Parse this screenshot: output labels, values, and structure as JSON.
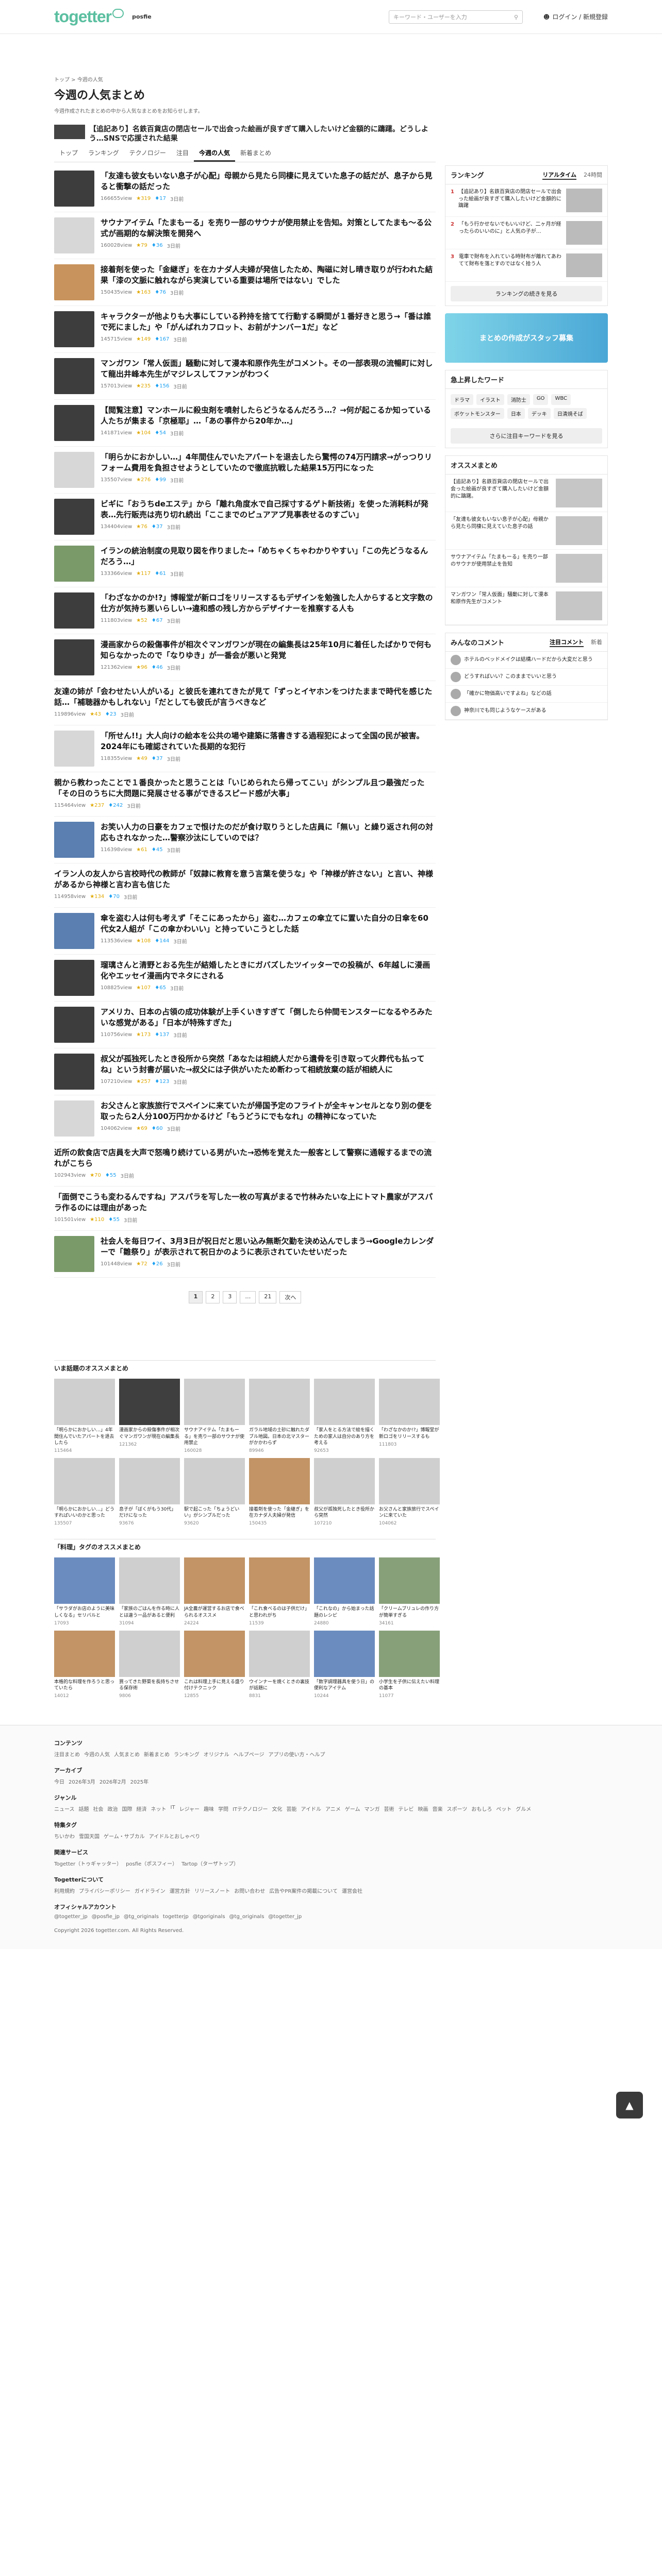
{
  "header": {
    "logo": "togetter",
    "partner": "posfie",
    "search_placeholder": "キーワード・ユーザーを入力",
    "login": "ログイン / 新規登録"
  },
  "breadcrumb": "トップ > 今週の人気",
  "page_title": "今週の人気まとめ",
  "page_desc": "今週作成されたまとめの中から人気なまとめをお知らせします。",
  "featured": "【追記あり】名鉄百貨店の閉店セールで出会った絵画が良すぎて購入したいけど金額的に躊躇。どうしよう…SNSで応援された結果",
  "tabs": [
    "トップ",
    "ランキング",
    "テクノロジー",
    "注目",
    "今週の人気",
    "新着まとめ"
  ],
  "items": [
    {
      "t": "「友達も彼女もいない息子が心配」母親から見たら同棲に見えていた息子の話だが、息子から見ると衝撃の話だった",
      "m": "166655view",
      "f": "319",
      "r": "17",
      "c": "3日前",
      "ph": "dark"
    },
    {
      "t": "サウナアイテム「たまもーる」を売り一部のサウナが使用禁止を告知。対策としてたまも〜る公式が画期的な解決策を開発へ",
      "m": "160028view",
      "f": "79",
      "r": "36",
      "c": "3日前",
      "ph": ""
    },
    {
      "t": "接着剤を使った「金継ぎ」を在カナダ人夫婦が発信したため、陶磁に対し晴き取りが行われた結果「漆の文脈に触れながら実演している重要は場所ではない」でした",
      "m": "150435view",
      "f": "163",
      "r": "76",
      "c": "3日前",
      "ph": "or"
    },
    {
      "t": "キャラクターが他よりも大事にしている矜持を捨てて行動する瞬間が１番好きと思う→「番は誰で死にました」や「がんばれカフロット、お前がナンバー1だ」など",
      "m": "145715view",
      "f": "149",
      "r": "167",
      "c": "3日前",
      "ph": "dark"
    },
    {
      "t": "マンガワン「常人仮面」騒動に対して漫本和原作先生がコメント。その一部表現の流暢町に対して龍出井峰本先生がマジレスしてファンがわつく",
      "m": "157013view",
      "f": "235",
      "r": "156",
      "c": "3日前",
      "ph": "dark"
    },
    {
      "t": "【閲覧注意】マンホールに殺虫剤を噴射したらどうなるんだろう…？→何が起こるか知っている人たちが集まる「京極耶」…「あの事件から20年か…」",
      "m": "141871view",
      "f": "104",
      "r": "54",
      "c": "3日前",
      "ph": "dark"
    },
    {
      "t": "「明らかにおかしい…」4年間住んでいたアパートを退去したら驚愕の74万円請求→がっつりリフォーム費用を負担させようとしていたので徹底抗戦した結果15万円になった",
      "m": "135507view",
      "f": "276",
      "r": "99",
      "c": "3日前",
      "ph": ""
    },
    {
      "t": "ビギに「おうちdeエステ」から「離れ角度水で自己採寸するゲト新技術」を使った消耗料が発表…先行販売は売り切れ続出「ここまでのピュアアプ見事表せるのすごい」",
      "m": "134404view",
      "f": "76",
      "r": "37",
      "c": "3日前",
      "ph": "dark"
    },
    {
      "t": "イランの統治制度の見取り図を作りました→「めちゃくちゃわかりやすい」「この先どうなるんだろう…」",
      "m": "133366view",
      "f": "117",
      "r": "61",
      "c": "3日前",
      "ph": "gr"
    },
    {
      "t": "「わざなかのか!?」博報堂が新ロゴをリリースするもデザインを勉強した人からすると文字数の仕方が気持ち悪いらしい→違和感の残し方からデザイナーを推察する人も",
      "m": "111803view",
      "f": "52",
      "r": "67",
      "c": "3日前",
      "ph": "dark"
    },
    {
      "t": "漫画家からの殺傷事件が相次ぐマンガワンが現在の編集長は25年10月に着任したばかりで何も知らなかったので「なりゆき」が一番会が悪いと発覚",
      "m": "121362view",
      "f": "96",
      "r": "46",
      "c": "3日前",
      "ph": "dark"
    },
    {
      "t": "友達の姉が「会わせたい人がいる」と彼氏を連れてきたが見て「ずっとイヤホンをつけたままで時代を感じた話…「補聴器かもしれない」「だとしても彼氏が言うべきなど",
      "m": "119896view",
      "f": "43",
      "r": "23",
      "c": "3日前",
      "ph": "none"
    },
    {
      "t": "「所せん!!」大人向けの絵本を公共の場や建築に落書きする過程犯によって全国の民が被害。2024年にも確認されていた長期的な犯行",
      "m": "118355view",
      "f": "49",
      "r": "37",
      "c": "3日前",
      "ph": ""
    },
    {
      "t": "親から教わったことで１番良かったと思うことは「いじめられたら帰ってこい」がシンプル且つ最強だった「その日のうちに大問題に発展させる事ができるスピード感が大事」",
      "m": "115464view",
      "f": "237",
      "r": "242",
      "c": "3日前",
      "ph": "none"
    },
    {
      "t": "お笑い人力の日豪をカフェで恨けたのだが食け取りうとした店員に「無い」と繰り返され何の対応もされなかった…警察沙汰にしていのでは？",
      "m": "116398view",
      "f": "61",
      "r": "45",
      "c": "3日前",
      "ph": "bl"
    },
    {
      "t": "イラン人の友人から言校時代の教師が「奴隷に教育を意う言葉を使うな」や「神様が許さない」と言い、神様があるから神様と言わ言も信じた",
      "m": "114958view",
      "f": "134",
      "r": "70",
      "c": "3日前",
      "ph": "none"
    },
    {
      "t": "傘を盗む人は何も考えず「そこにあったから」盗む…カフェの傘立てに置いた自分の日傘を60代女2人組が「この傘かわいい」と持っていこうとした話",
      "m": "113536view",
      "f": "108",
      "r": "144",
      "c": "3日前",
      "ph": "bl"
    },
    {
      "t": "瑠璃さんと清野とおる先生が結婚したときにガバズしたツイッターでの投稿が、6年越しに漫画化やエッセイ漫画内でネタにされる",
      "m": "108825view",
      "f": "107",
      "r": "65",
      "c": "3日前",
      "ph": "dark"
    },
    {
      "t": "アメリカ、日本の占領の成功体験が上手くいきすぎて「倒したら仲間モンスターになるやろみたいな感覚がある」「日本が特殊すぎた」",
      "m": "110756view",
      "f": "173",
      "r": "137",
      "c": "3日前",
      "ph": "dark"
    },
    {
      "t": "叔父が孤独死したとき役所から突然「あなたは相続人だから遺骨を引き取って火葬代も払ってね」という封書が届いた→叔父には子供がいたため断わって相続放棄の話が相続人に",
      "m": "107210view",
      "f": "257",
      "r": "123",
      "c": "3日前",
      "ph": "dark"
    },
    {
      "t": "お父さんと家族旅行でスペインに来ていたが帰国予定のフライトが全キャンセルとなり別の便を取ったら2人分100万円かかるけど「もうどうにでもなれ」の精神になっていた",
      "m": "104062view",
      "f": "69",
      "r": "60",
      "c": "3日前",
      "ph": ""
    },
    {
      "t": "近所の飲食店で店員を大声で怒鳴り続けている男がいた→恐怖を覚えた一般客として警察に通報するまでの流れがこちら",
      "m": "102943view",
      "f": "70",
      "r": "55",
      "c": "3日前",
      "ph": "none"
    },
    {
      "t": "「面倒でこうも変わるんですね」アスパラを写した一枚の写真がまるで竹林みたいな上にトマト農家がアスパラ作るのには理由があった",
      "m": "101501view",
      "f": "110",
      "r": "55",
      "c": "3日前",
      "ph": "none"
    },
    {
      "t": "社会人を毎日ワイ、3月3日が祝日だと思い込み無断欠勤を決め込んでしまう→Googleカレンダーで「雛祭り」が表示されて祝日かのように表示されていたせいだった",
      "m": "101448view",
      "f": "72",
      "r": "26",
      "c": "3日前",
      "ph": "gr"
    }
  ],
  "pager": [
    "1",
    "2",
    "3",
    "…",
    "21",
    "次へ"
  ],
  "side": {
    "ranking_title": "ランキング",
    "ranking_tabs": [
      "リアルタイム",
      "24時間"
    ],
    "ranking": [
      "【追記あり】名鉄百貨店の閉店セールで出会った絵画が良すぎて購入したいけど金額的に躊躇",
      "「もう行かせないでもいいけど、二ヶ月が経ったらのいいのに」と人気の子が…",
      "電車で財布を入れている時財布が離れてあわてて財布を落とすのではなく拾う人"
    ],
    "ranking_more": "ランキングの続きを見る",
    "banner": "まとめの作成がスタッフ募集",
    "kw_title": "急上昇したワード",
    "kw": [
      "ドラマ",
      "イラスト",
      "消防士",
      "GO",
      "WBC",
      "ボケットモンスター",
      "日本",
      "デッキ",
      "日清焼そば"
    ],
    "kw_more": "さらに注目キーワードを見る",
    "osusume_title": "オススメまとめ",
    "osusume": [
      "【追記あり】名鉄百貨店の閉店セールで出会った絵画が良すぎて購入したいけど金額的に躊躇。",
      "「友達も彼女もいない息子が心配」母親から見たら同棲に見えていた息子の話",
      "サウナアイテム「たまもーる」を売り一部のサウナが使用禁止を告知",
      "マンガワン「常人仮面」騒動に対して漫本和原作先生がコメント"
    ],
    "comments_title": "みんなのコメント",
    "comments_tabs": [
      "注目コメント",
      "新着"
    ],
    "comments": [
      "ホテルのベッドメイクは結構ハードだから大変だと思う",
      "どうすればいい？このままでいいと思う",
      "「確かに物価高いですよね」などの話",
      "神奈川でも同じようなケースがある"
    ]
  },
  "section1_title": "いま話題のオススメまとめ",
  "section1": [
    {
      "t": "「明らかにおかしい…」4年間住んでいたアパートを退去したら",
      "m": "115464",
      "c": "dark"
    },
    {
      "t": "漫画家からの殺傷事件が相次ぐマンガワンが現在の編集長",
      "m": "121362",
      "c": "d"
    },
    {
      "t": "サウナアイテム「たまもーる」を売り一部のサウナが使用禁止",
      "m": "160028",
      "c": ""
    },
    {
      "t": "ガラル地域の土砂に触れたダブル地図。日本の北マスターがかかわらず",
      "m": "89946",
      "c": ""
    },
    {
      "t": "「家人をとる方法で絵を描くための家人は自分のあり方を考える",
      "m": "92653",
      "c": ""
    },
    {
      "t": "「わざなかのか!?」博報堂が新ロゴをリリースするも",
      "m": "111803",
      "c": ""
    },
    {
      "t": "「明らかにおかしい…」どうすればいいのかと思った",
      "m": "135507",
      "c": ""
    },
    {
      "t": "息子が「ぼくがもう30代」だけになった",
      "m": "93676",
      "c": ""
    },
    {
      "t": "駅で起こった「ちょうどいい」がシンプルだった",
      "m": "93620",
      "c": ""
    },
    {
      "t": "接着剤を使った「金継ぎ」を在カナダ人夫婦が発信",
      "m": "150435",
      "c": "o"
    },
    {
      "t": "叔父が孤独死したとき役所から突然",
      "m": "107210",
      "c": ""
    },
    {
      "t": "お父さんと家族旅行でスペインに来ていた",
      "m": "104062",
      "c": ""
    }
  ],
  "section2_title": "「料理」タグのオススメまとめ",
  "section2": [
    {
      "t": "「サラダがお店のように美味しくなる」セリバルと",
      "m": "17093",
      "c": "b"
    },
    {
      "t": "「家族のごはんを作る時に人とは違う一品があると便利",
      "m": "31094",
      "c": ""
    },
    {
      "t": "JA全農が運営するお店で食べられるオススメ",
      "m": "24224",
      "c": "o"
    },
    {
      "t": "「これ食べるのは子供だけ」と思われがち",
      "m": "11539",
      "c": "o"
    },
    {
      "t": "「これなの」から始まった話題のレシピ",
      "m": "24880",
      "c": "b"
    },
    {
      "t": "「クリームブリュレの作り方が簡単すぎる",
      "m": "34161",
      "c": "g"
    },
    {
      "t": "本格的な料理を作ろうと思っていたら",
      "m": "14012",
      "c": "o"
    },
    {
      "t": "買ってきた野菜を長持ちさせる保存術",
      "m": "9806",
      "c": ""
    },
    {
      "t": "これは料理上手に見える盛り付けテクニック",
      "m": "12855",
      "c": "o"
    },
    {
      "t": "ウインナーを焼くときの裏技が話題に",
      "m": "8831",
      "c": ""
    },
    {
      "t": "「数字調理器具を使う日」の便利なアイテム",
      "m": "10244",
      "c": "b"
    },
    {
      "t": "小学生を子供に伝えたい料理の基本",
      "m": "11077",
      "c": "g"
    }
  ],
  "footer": {
    "content_h": "コンテンツ",
    "content_l": [
      "注目まとめ",
      "今週の人気",
      "人気まとめ",
      "新着まとめ",
      "ランキング",
      "オリジナル",
      "ヘルプページ",
      "アプリの使い方・ヘルプ"
    ],
    "archive_h": "アーカイブ",
    "archive_l": [
      "今日",
      "2026年3月",
      "2026年2月",
      "2025年"
    ],
    "genre_h": "ジャンル",
    "genre_l": [
      "ニュース",
      "話題",
      "社会",
      "政治",
      "国際",
      "経済",
      "ネット",
      "IT",
      "レジャー",
      "趣味",
      "学問",
      "ITテクノロジー",
      "文化",
      "芸能",
      "アイドル",
      "アニメ",
      "ゲーム",
      "マンガ",
      "芸術",
      "テレビ",
      "映画",
      "音楽",
      "スポーツ",
      "おもしろ",
      "ペット",
      "グルメ"
    ],
    "tag_h": "特集タグ",
    "tag_l": [
      "ちいかわ",
      "雪国天国",
      "ゲーム・サブカル",
      "アイドルとおしゃべり"
    ],
    "service_h": "関連サービス",
    "service_l": [
      "Togetter（トゥギャッター）",
      "posfie（ポスフィー）",
      "Tartop（ターザトップ）"
    ],
    "about_h": "Togetterについて",
    "about_l": [
      "利用規約",
      "プライバシーポリシー",
      "ガイドライン",
      "運営方針",
      "リリースノート",
      "お問い合わせ",
      "広告やPR案件の掲載について",
      "運営会社"
    ],
    "official_h": "オフィシャルアカウント",
    "official_l": [
      "@togetter_jp",
      "@posfie_jp",
      "@tg_originals",
      "togetterjp",
      "@tgoriginals",
      "@tg_originals",
      "@togetter_jp"
    ],
    "copyright": "Copyright 2026 togetter.com. All Rights Reserved."
  }
}
